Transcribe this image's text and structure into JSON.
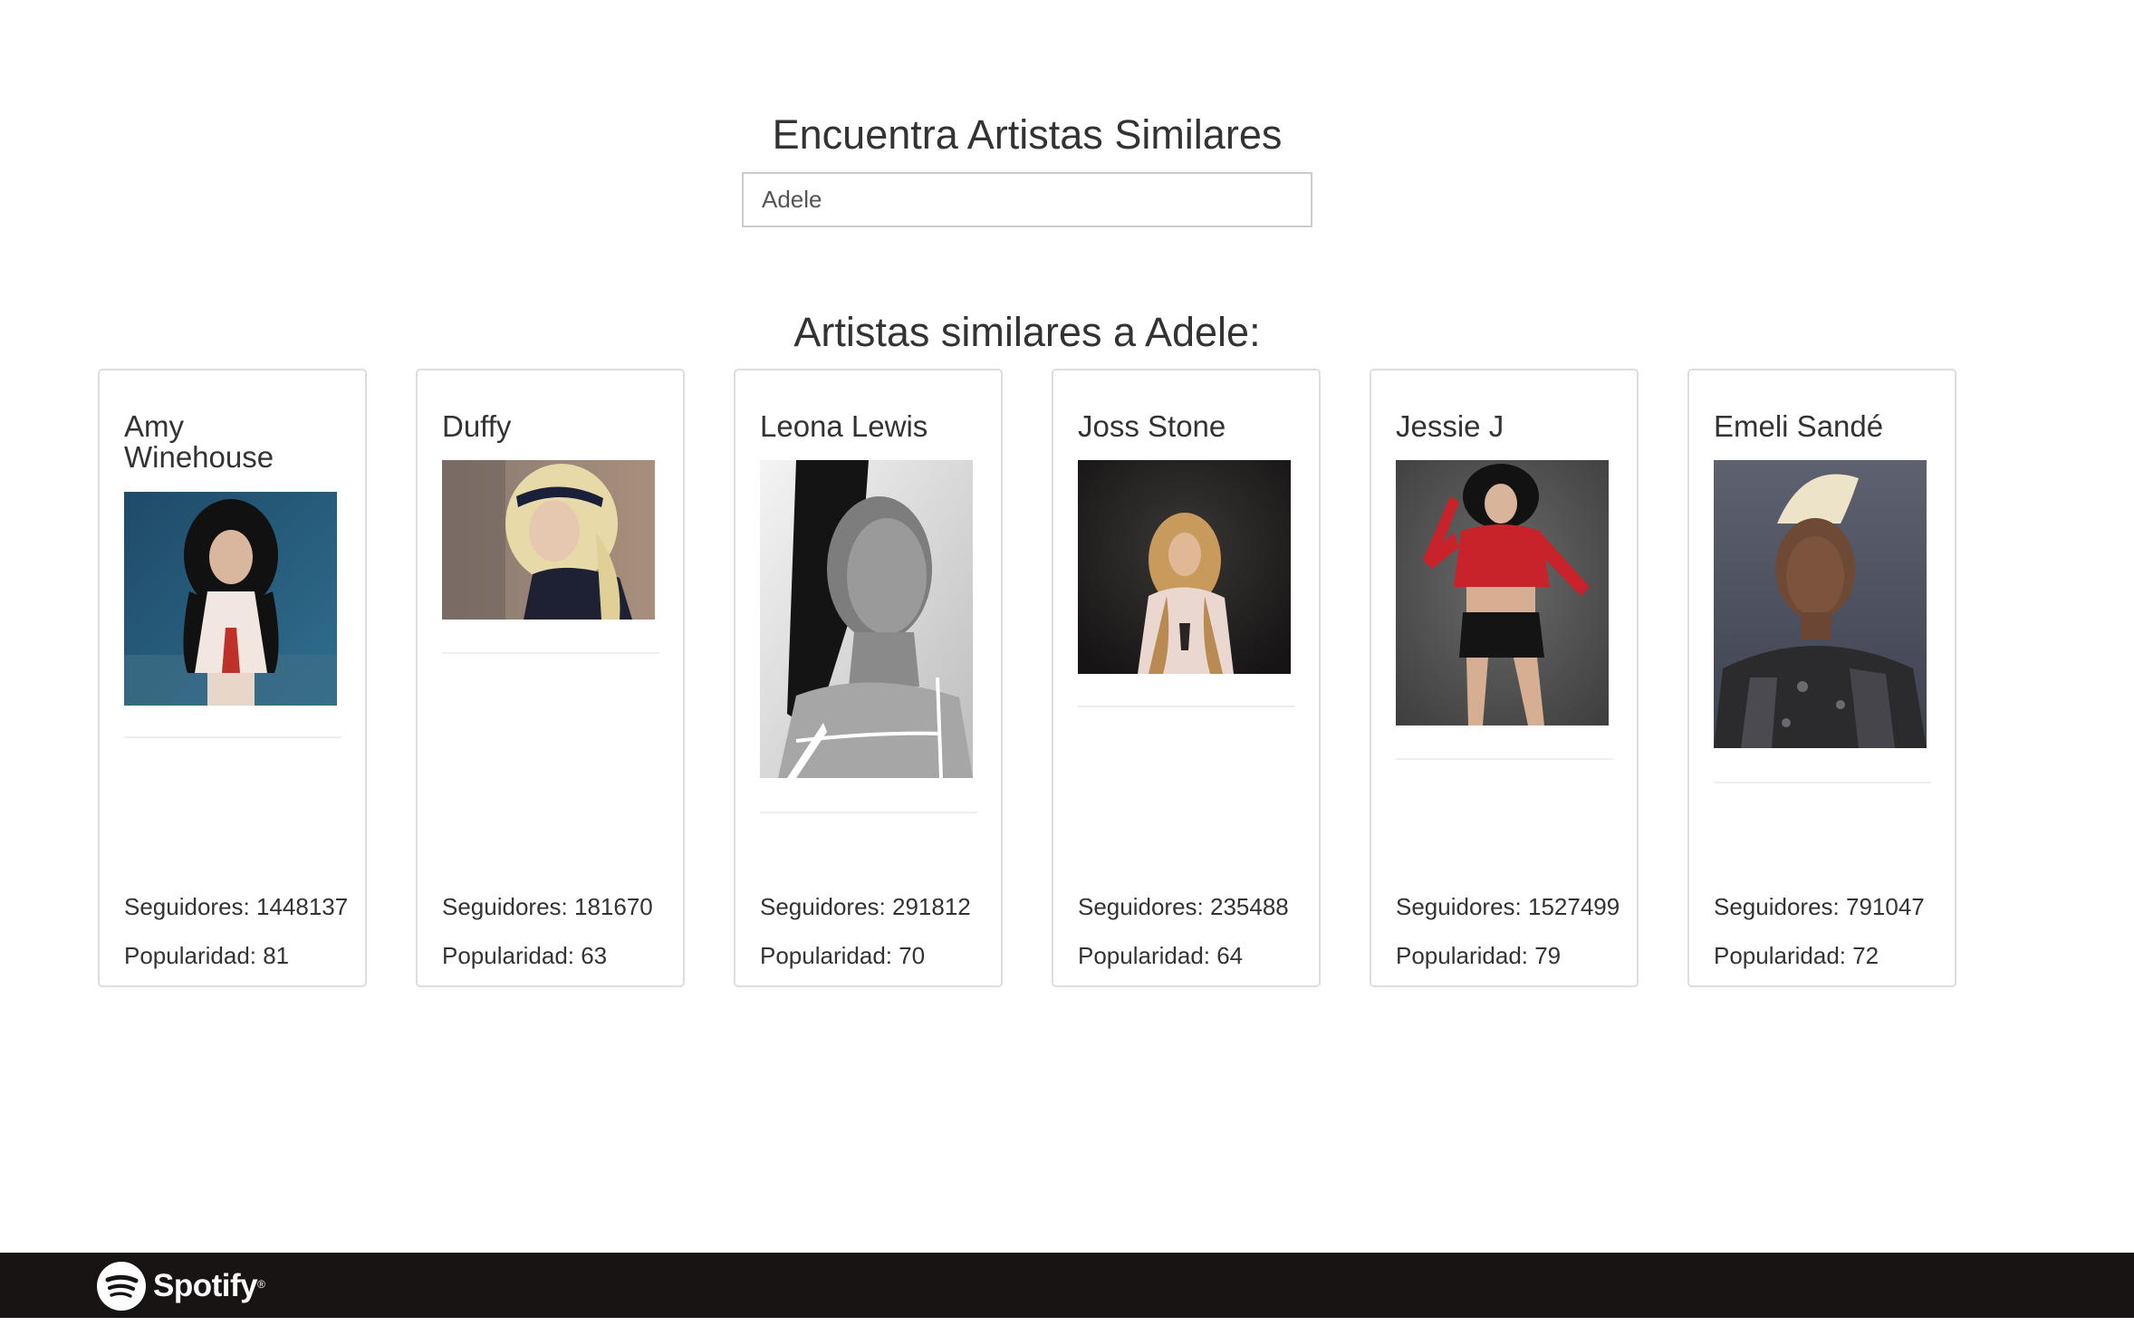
{
  "page": {
    "title": "Encuentra Artistas Similares",
    "search_value": "Adele",
    "results_heading": "Artistas similares a Adele:"
  },
  "artists": [
    {
      "name": "Amy Winehouse",
      "followers": "Seguidores: 1448137",
      "popularity": "Popularidad: 81"
    },
    {
      "name": "Duffy",
      "followers": "Seguidores: 181670",
      "popularity": "Popularidad: 63"
    },
    {
      "name": "Leona Lewis",
      "followers": "Seguidores: 291812",
      "popularity": "Popularidad: 70"
    },
    {
      "name": "Joss Stone",
      "followers": "Seguidores: 235488",
      "popularity": "Popularidad: 64"
    },
    {
      "name": "Jessie J",
      "followers": "Seguidores: 1527499",
      "popularity": "Popularidad: 79"
    },
    {
      "name": "Emeli Sandé",
      "followers": "Seguidores: 791047",
      "popularity": "Popularidad: 72"
    }
  ],
  "footer": {
    "brand": "Spotify",
    "trademark": "®",
    "logo_icon": "spotify-logo-icon",
    "background_color": "#191414"
  }
}
